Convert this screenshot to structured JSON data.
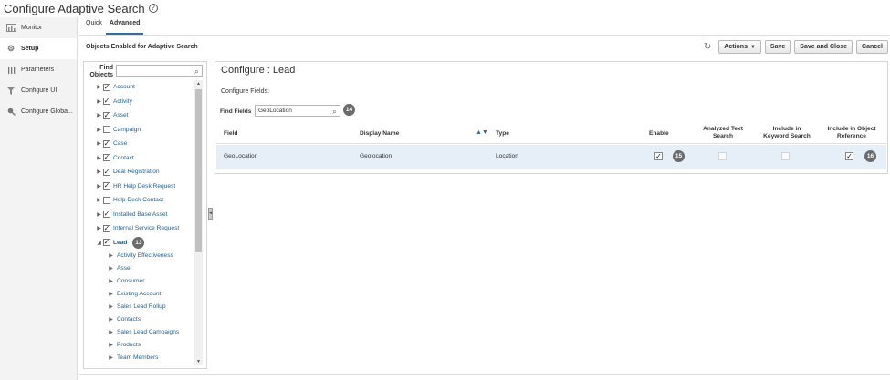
{
  "page": {
    "title": "Configure Adaptive Search",
    "help_icon": "?"
  },
  "leftnav": {
    "items": [
      {
        "label": "Monitor",
        "icon": "chart-icon"
      },
      {
        "label": "Setup",
        "icon": "gears-icon",
        "active": true
      },
      {
        "label": "Parameters",
        "icon": "sliders-icon"
      },
      {
        "label": "Configure UI",
        "icon": "filter-icon"
      },
      {
        "label": "Configure Globa...",
        "icon": "pin-icon"
      }
    ]
  },
  "tabs": [
    {
      "label": "Quick"
    },
    {
      "label": "Advanced",
      "active": true
    }
  ],
  "objects_label": "Objects Enabled for Adaptive Search",
  "toolbar": {
    "actions_label": "Actions",
    "actions_caret": "▼",
    "save_label": "Save",
    "save_close_label": "Save and Close",
    "cancel_label": "Cancel"
  },
  "tree": {
    "find_label": "Find Objects",
    "find_value": "",
    "items": [
      {
        "label": "Account",
        "checked": true,
        "caret": "▶"
      },
      {
        "label": "Activity",
        "checked": true,
        "caret": "▶"
      },
      {
        "label": "Asset",
        "checked": true,
        "caret": "▶"
      },
      {
        "label": "Campaign",
        "checked": false,
        "caret": "▶"
      },
      {
        "label": "Case",
        "checked": true,
        "caret": "▶"
      },
      {
        "label": "Contact",
        "checked": true,
        "caret": "▶"
      },
      {
        "label": "Deal Registration",
        "checked": true,
        "caret": "▶"
      },
      {
        "label": "HR Help Desk Request",
        "checked": true,
        "caret": "▶"
      },
      {
        "label": "Help Desk Contact",
        "checked": false,
        "caret": "▶"
      },
      {
        "label": "Installed Base Asset",
        "checked": true,
        "caret": "▶"
      },
      {
        "label": "Internal Service Request",
        "checked": true,
        "caret": "▶"
      },
      {
        "label": "Lead",
        "checked": true,
        "caret": "◢",
        "bold": true,
        "badge": "13"
      }
    ],
    "children": [
      "Activity Effectiveness",
      "Asset",
      "Consumer",
      "Existing Account",
      "Sales Lead Rollup",
      "Contacts",
      "Sales Lead Campaigns",
      "Products",
      "Team Members"
    ],
    "child_caret": "▶"
  },
  "configure": {
    "title": "Configure : Lead",
    "fields_label": "Configure Fields:",
    "find_label": "Find Fields",
    "find_value": "GeoLocation",
    "find_badge": "14",
    "columns": {
      "field": "Field",
      "display_name": "Display Name",
      "type": "Type",
      "enable": "Enable",
      "analyzed_1": "Analyzed Text",
      "analyzed_2": "Search",
      "keyword_1": "Include in",
      "keyword_2": "Keyword Search",
      "objref_1": "Include in Object",
      "objref_2": "Reference"
    },
    "row": {
      "field": "GeoLocation",
      "display_name": "Geolocation",
      "type": "Location",
      "enable_checked": true,
      "enable_badge": "15",
      "analyzed_checked": false,
      "keyword_checked": false,
      "objref_checked": true,
      "objref_badge": "16"
    }
  },
  "colors": {
    "link": "#1f5f8f",
    "selected_row": "#e6eff8",
    "badge": "#6b6b6b",
    "tab_underline": "#3b6a9c"
  }
}
